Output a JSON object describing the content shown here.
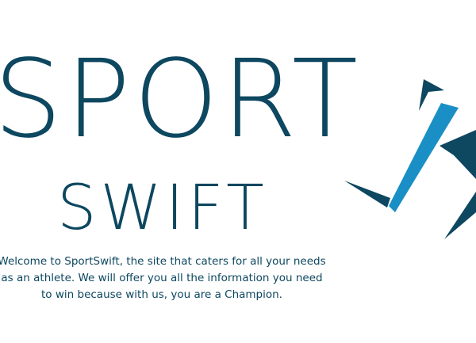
{
  "hero": {
    "title_line1": "SPORT",
    "title_line2": "SWIFT",
    "intro": "Welcome to SportSwift, the site that caters for all your needs as an athlete. We will offer you all the information you need to win because with us, you are a Champion."
  },
  "logo": {
    "icon": "runner-icon",
    "colors": {
      "dark": "#0d4760",
      "bright": "#1a8fc6"
    }
  }
}
